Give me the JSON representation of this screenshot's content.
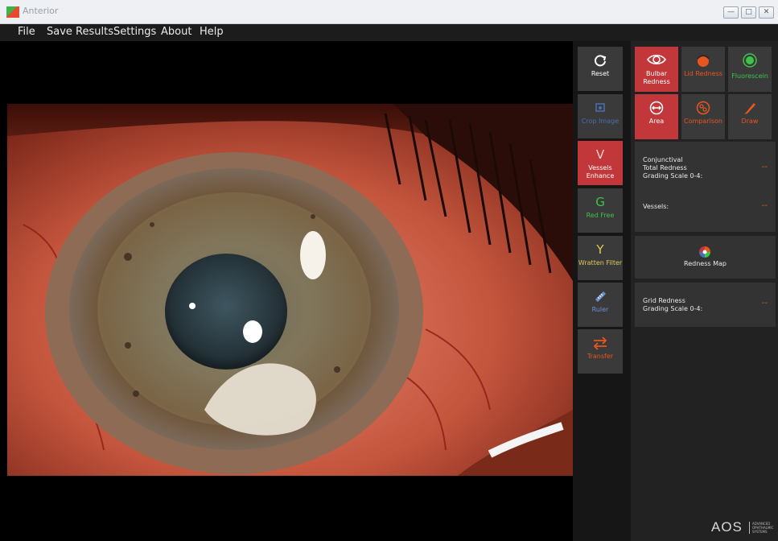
{
  "window": {
    "title": "Anterior",
    "controls": [
      "minimize",
      "maximize",
      "close"
    ]
  },
  "menu": [
    "File",
    "Save Results",
    "Settings",
    "About",
    "Help"
  ],
  "tools": [
    {
      "label": "Reset",
      "icon": "reset-icon",
      "active": false
    },
    {
      "label": "Crop Image",
      "icon": "crop-icon",
      "active": false
    },
    {
      "label": "Vessels Enhance",
      "glyph": "V",
      "active": true
    },
    {
      "label": "Red Free",
      "glyph": "G",
      "active": false
    },
    {
      "label": "Wratten Filter",
      "glyph": "Y",
      "active": false
    },
    {
      "label": "Ruler",
      "icon": "ruler-icon",
      "active": false
    },
    {
      "label": "Transfer",
      "icon": "transfer-icon",
      "active": false
    }
  ],
  "modes": [
    {
      "label": "Bulbar Redness",
      "icon": "eye-icon",
      "active": true
    },
    {
      "label": "Lid Redness",
      "icon": "lid-icon",
      "active": false
    },
    {
      "label": "Fluorescein",
      "icon": "fluorescein-icon",
      "active": false
    },
    {
      "label": "Area",
      "icon": "area-icon",
      "active": true
    },
    {
      "label": "Comparison",
      "icon": "comparison-icon",
      "active": false
    },
    {
      "label": "Draw",
      "icon": "pencil-icon",
      "active": false
    }
  ],
  "results": {
    "conjunctival_label": "Conjunctival\nTotal Redness\nGrading Scale 0-4:",
    "conjunctival_value": "--",
    "vessels_label": "Vessels:",
    "vessels_value": "--",
    "redness_map_label": "Redness Map",
    "grid_label": "Grid Redness\nGrading Scale 0-4:",
    "grid_value": "--"
  },
  "logo": {
    "text": "AOS",
    "sub": "ADVANCED OPHTHALMIC SYSTEMS"
  },
  "colors": {
    "accent_red": "#c1373a",
    "orange": "#e8561f",
    "green": "#3ec44b",
    "blue": "#4a6fb0",
    "panel": "#3a3a3a"
  }
}
